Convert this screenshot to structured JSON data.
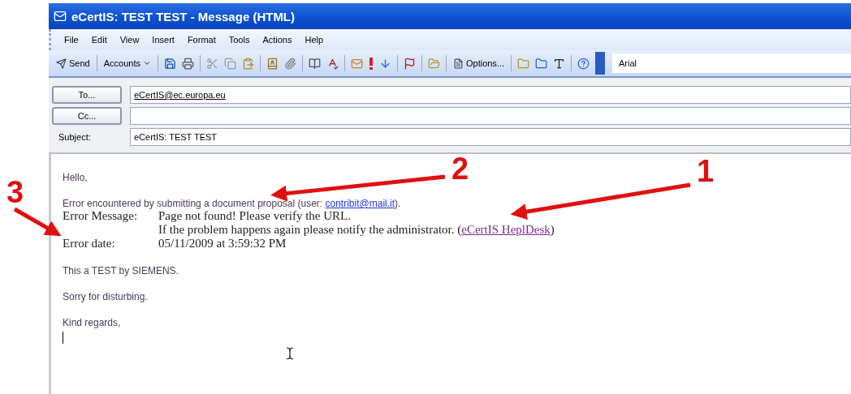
{
  "window": {
    "title": "eCertIS: TEST TEST - Message (HTML)"
  },
  "menu": [
    {
      "label": "File"
    },
    {
      "label": "Edit"
    },
    {
      "label": "View"
    },
    {
      "label": "Insert"
    },
    {
      "label": "Format"
    },
    {
      "label": "Tools"
    },
    {
      "label": "Actions"
    },
    {
      "label": "Help"
    }
  ],
  "toolbar": {
    "send": "Send",
    "accounts": "Accounts",
    "options": "Options...",
    "font": "Arial"
  },
  "header": {
    "to_button": "To...",
    "to": "eCertIS@ec.europa.eu",
    "cc_button": "Cc...",
    "subject_label": "Subject:",
    "subject": "eCertIS: TEST TEST"
  },
  "body": {
    "greeting": "Hello,",
    "error_line": {
      "text": "Error encountered by submitting a document proposal (user: ",
      "link": "contribit@mail.it",
      "after": ")."
    },
    "error_details": [
      {
        "label": "Error Message:",
        "lines": [
          {
            "text": "Page not found! Please verify the URL."
          },
          {
            "text": "If the problem happens again please notify the administrator. (",
            "link": "eCertIS HeplDesk",
            "after": ")"
          }
        ]
      },
      {
        "label": "Error date:",
        "lines": [
          {
            "text": "05/11/2009 at 3:59:32 PM"
          }
        ]
      }
    ],
    "paragraphs": [
      "This a TEST by SIEMENS.",
      "Sorry for disturbing.",
      "Kind regards,"
    ]
  },
  "annotations": [
    {
      "label": "1"
    },
    {
      "label": "2"
    },
    {
      "label": "3"
    }
  ]
}
